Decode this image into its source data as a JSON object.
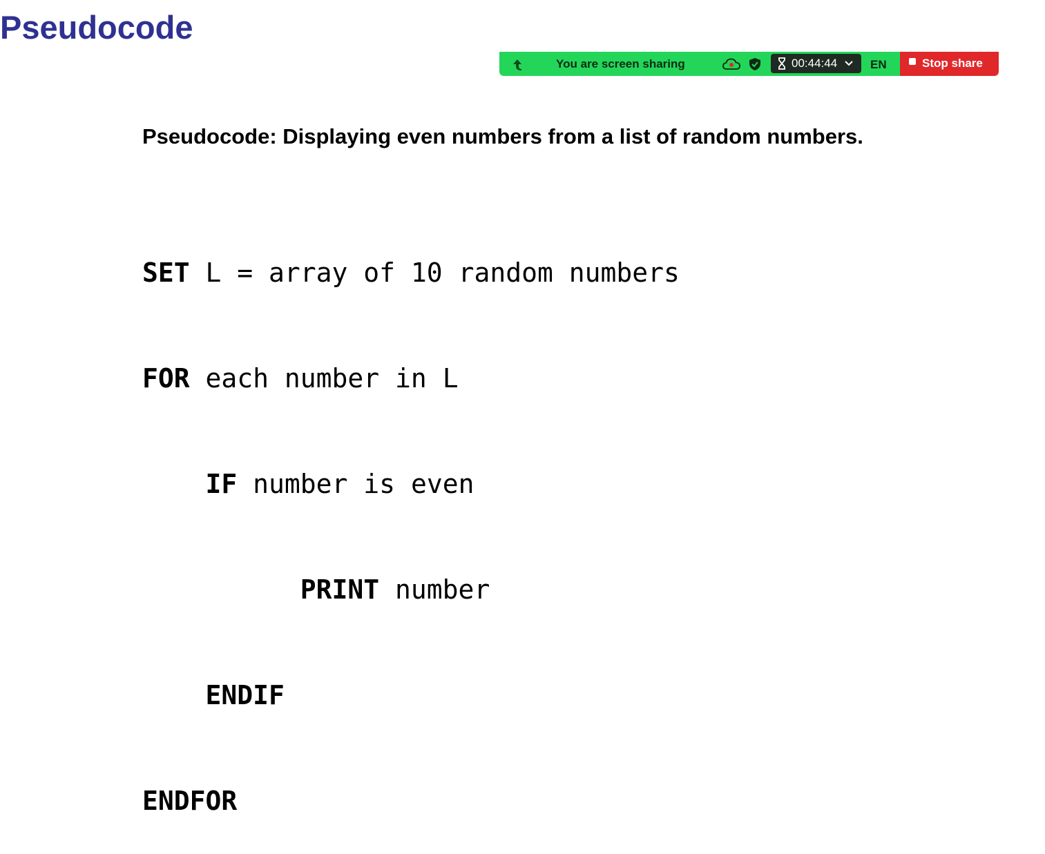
{
  "slide": {
    "title": "Pseudocode",
    "subtitle": "Pseudocode: Displaying even numbers from a list of random numbers."
  },
  "share_bar": {
    "status_text": "You are screen sharing",
    "timer": "00:44:44",
    "language": "EN",
    "stop_label": "Stop share",
    "colors": {
      "bar": "#23d65a",
      "timer_bg": "#1f2a22",
      "stop": "#e0282a"
    },
    "icons": [
      "collapse-arrow-icon",
      "cloud-record-icon",
      "shield-check-icon",
      "hourglass-icon",
      "chevron-down-icon",
      "stop-square-icon"
    ]
  },
  "code": {
    "lines": [
      {
        "indent": "",
        "keyword": "SET",
        "rest": " L = array of 10 random numbers"
      },
      {
        "indent": "",
        "keyword": "FOR",
        "rest": " each number in L"
      },
      {
        "indent": "    ",
        "keyword": "IF",
        "rest": " number is even"
      },
      {
        "indent": "          ",
        "keyword": "PRINT",
        "rest": " number"
      },
      {
        "indent": "    ",
        "keyword": "ENDIF",
        "rest": ""
      },
      {
        "indent": "",
        "keyword": "ENDFOR",
        "rest": ""
      }
    ]
  }
}
